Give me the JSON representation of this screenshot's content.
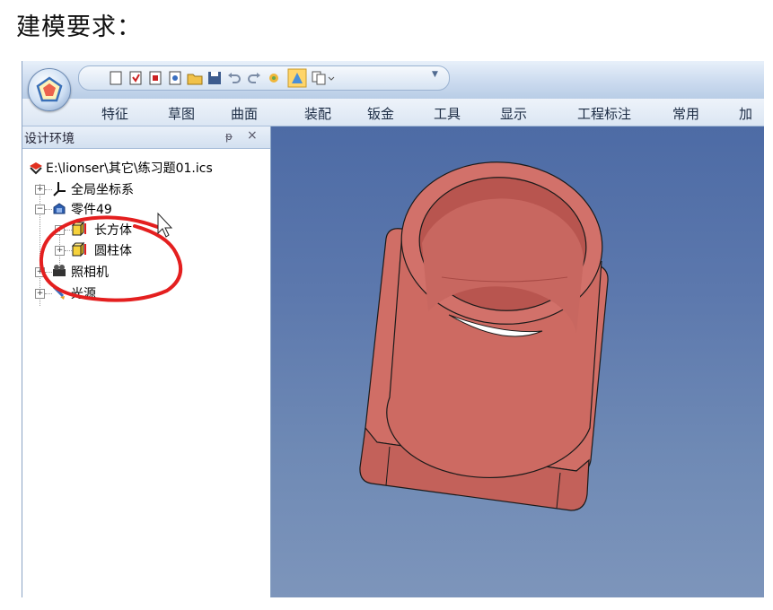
{
  "heading": "建模要求：",
  "menu": [
    "特征",
    "草图",
    "曲面",
    "装配",
    "钣金",
    "工具",
    "显示",
    "工程标注",
    "常用",
    "加"
  ],
  "panel": {
    "title": "设计环境",
    "pin_icon": "pin-icon",
    "close_icon": "close-icon"
  },
  "tree": {
    "root": "E:\\lionser\\其它\\练习题01.ics",
    "items": [
      {
        "label": "全局坐标系",
        "icon": "coordinate-axes-icon"
      },
      {
        "label": "零件49",
        "icon": "part-icon"
      },
      {
        "label": "长方体",
        "icon": "block-icon"
      },
      {
        "label": "圆柱体",
        "icon": "cylinder-icon"
      },
      {
        "label": "照相机",
        "icon": "camera-icon"
      },
      {
        "label": "光源",
        "icon": "light-icon"
      }
    ]
  },
  "colors": {
    "ribbon_bg": "#c9d9ee",
    "viewport_top": "#4d6ba5",
    "viewport_bottom": "#7d95bb",
    "model": "#cd6a62",
    "annotation": "#e41f1f"
  }
}
